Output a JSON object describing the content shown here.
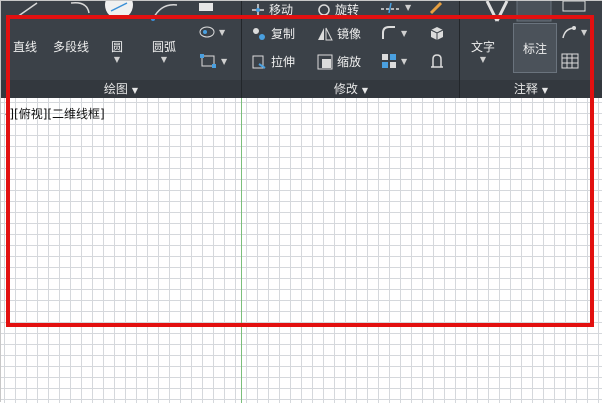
{
  "ribbon": {
    "draw_panel": {
      "title": "绘图",
      "line": "直线",
      "polyline": "多段线",
      "circle": "圆",
      "arc": "圆弧"
    },
    "modify_panel": {
      "title": "修改",
      "move": "移动",
      "rotate": "旋转",
      "copy": "复制",
      "mirror": "镜像",
      "stretch": "拉伸",
      "scale": "缩放"
    },
    "annotation_panel": {
      "title": "注释",
      "text": "文字",
      "dimension": "标注"
    }
  },
  "viewport": {
    "label": "-][俯视][二维线框]"
  },
  "colors": {
    "ribbon_bg": "#3b4148",
    "highlight_border": "#e21010",
    "y_axis": "#7bbf7b"
  }
}
